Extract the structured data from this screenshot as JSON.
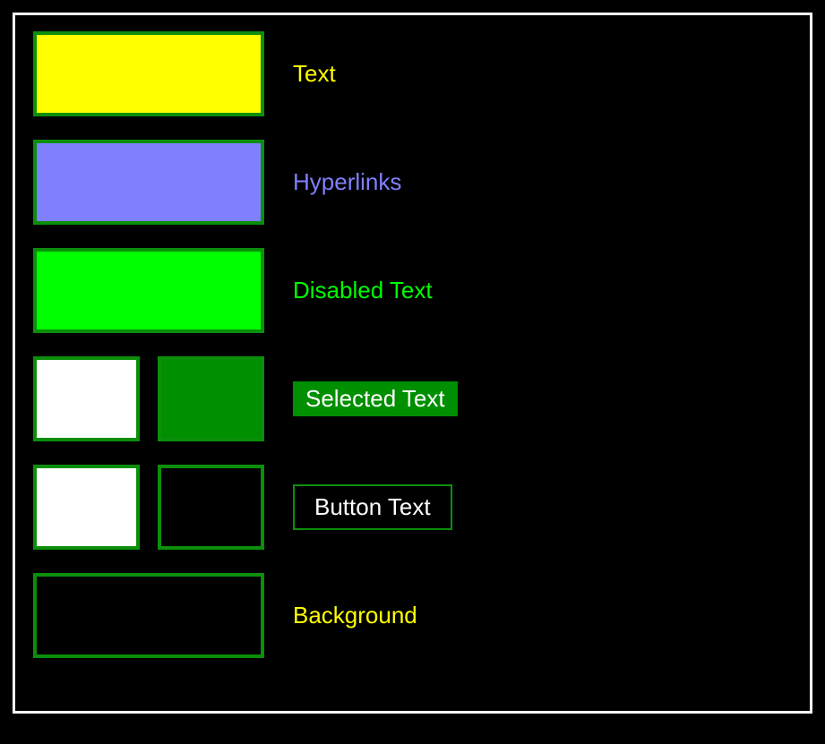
{
  "rows": {
    "text": {
      "label": "Text",
      "swatch_color": "#ffff00",
      "label_color": "#ffff00"
    },
    "hyperlinks": {
      "label": "Hyperlinks",
      "swatch_color": "#8080ff",
      "label_color": "#8080ff"
    },
    "disabled": {
      "label": "Disabled Text",
      "swatch_color": "#00ff00",
      "label_color": "#00ff00"
    },
    "selected": {
      "label": "Selected Text",
      "swatch_left": "#ffffff",
      "swatch_right": "#008f00"
    },
    "button": {
      "label": "Button Text",
      "swatch_left": "#ffffff",
      "swatch_right": "#000000"
    },
    "background": {
      "label": "Background",
      "swatch_color": "#000000",
      "label_color": "#ffff00"
    }
  }
}
